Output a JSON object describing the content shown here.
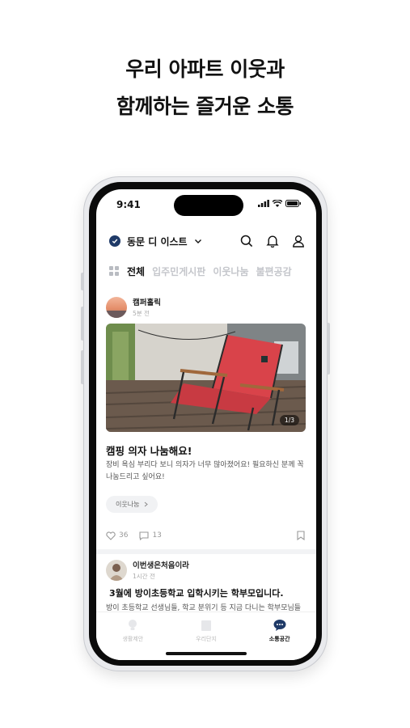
{
  "headline": {
    "line1": "우리 아파트 이웃과",
    "line2": "함께하는 즐거운 소통"
  },
  "status_bar": {
    "time": "9:41"
  },
  "top_bar": {
    "apartment_name": "동문 디 이스트",
    "icons": [
      "check-badge-icon",
      "chevron-down-icon",
      "search-icon",
      "bell-icon",
      "profile-icon"
    ]
  },
  "tabs": [
    {
      "label": "전체",
      "active": true
    },
    {
      "label": "입주민게시판",
      "active": false
    },
    {
      "label": "이웃나눔",
      "active": false
    },
    {
      "label": "불편공감",
      "active": false
    }
  ],
  "posts": [
    {
      "author": "캠퍼홀릭",
      "time": "5분 전",
      "photo_counter": "1/3",
      "title": "캠핑 의자 나눔해요!",
      "body": "장비 욕심 부리다 보니 의자가 너무 많아졌어요! 필요하신 분께 꼭 나눔드리고 싶어요!",
      "category_chip": "이웃나눔",
      "likes": "36",
      "comments": "13"
    },
    {
      "author": "이번생은처음이라",
      "time": "1시간 전",
      "title": "3월에 방이초등학교 입학시키는 학부모입니다.",
      "body": "방이 초등학교 선생님들, 학교 분위기 등 지금 다니는 학부모님들 의견이 궁금해 여쭤보고 싶어요."
    }
  ],
  "bottom_nav": [
    {
      "label": "생활제안",
      "icon": "lightbulb-icon",
      "active": false
    },
    {
      "label": "우리단지",
      "icon": "building-icon",
      "active": false
    },
    {
      "label": "소통공간",
      "icon": "chat-bubble-icon",
      "active": true
    }
  ],
  "colors": {
    "brand_navy": "#1f3a68",
    "chair_red": "#d9434a",
    "inactive_gray": "#c4c6cb"
  }
}
